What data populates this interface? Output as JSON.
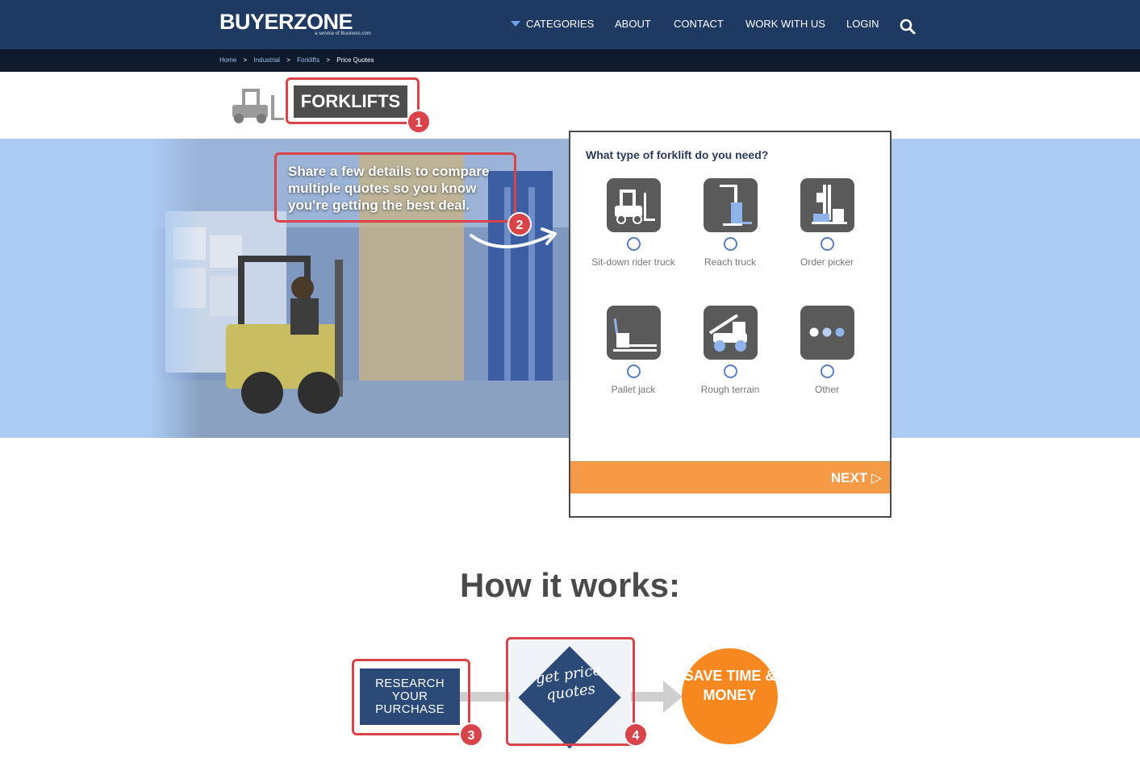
{
  "header": {
    "logo_text": "BUYERZONE",
    "logo_sub": "a service of Business.com",
    "nav": {
      "categories": "CATEGORIES",
      "about": "ABOUT",
      "contact": "CONTACT",
      "work_with_us": "WORK WITH US",
      "login": "LOGIN"
    }
  },
  "breadcrumb": {
    "home": "Home",
    "industrial": "Industrial",
    "forklifts": "Forklifts",
    "current": "Price Quotes",
    "separator": ">"
  },
  "page_title": "FORKLIFTS",
  "hero": {
    "text": "Share a few details to compare multiple quotes so you know you're getting the best deal."
  },
  "form": {
    "question": "What type of forklift do you need?",
    "options": [
      {
        "label": "Sit-down rider truck",
        "icon": "sit-down-forklift-icon"
      },
      {
        "label": "Reach truck",
        "icon": "reach-truck-icon"
      },
      {
        "label": "Order picker",
        "icon": "order-picker-icon"
      },
      {
        "label": "Pallet jack",
        "icon": "pallet-jack-icon"
      },
      {
        "label": "Rough terrain",
        "icon": "rough-terrain-icon"
      },
      {
        "label": "Other",
        "icon": "more-dots-icon"
      }
    ],
    "next_label": "NEXT ▷"
  },
  "how_it_works": {
    "title": "How it works:",
    "step1": "RESEARCH YOUR PURCHASE",
    "step2": "get price quotes",
    "step3": "SAVE TIME & MONEY"
  },
  "annotations": [
    "1",
    "2",
    "3",
    "4"
  ],
  "colors": {
    "header_bg": "#1e3a62",
    "crumb_bg": "#0d1a2c",
    "hero_bg": "#acccf3",
    "accent_orange": "#f59a47",
    "annotation_red": "#d9444a",
    "step_blue": "#2c4a78"
  }
}
